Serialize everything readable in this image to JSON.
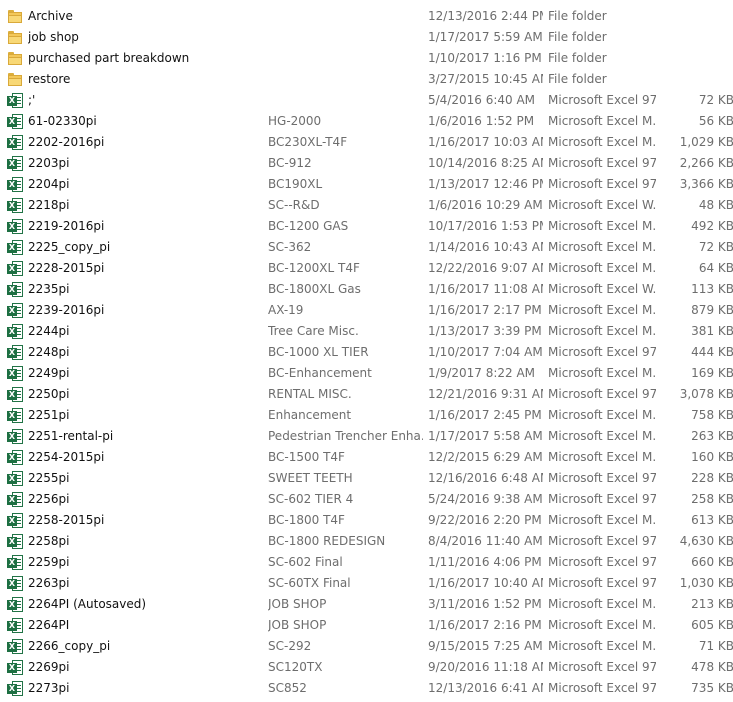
{
  "files": [
    {
      "name": "Archive",
      "title": "",
      "date": "12/13/2016 2:44 PM",
      "type": "File folder",
      "size": "",
      "icon": "folder-icon"
    },
    {
      "name": "job shop",
      "title": "",
      "date": "1/17/2017 5:59 AM",
      "type": "File folder",
      "size": "",
      "icon": "folder-icon"
    },
    {
      "name": "purchased part breakdown",
      "title": "",
      "date": "1/10/2017 1:16 PM",
      "type": "File folder",
      "size": "",
      "icon": "folder-icon"
    },
    {
      "name": "restore",
      "title": "",
      "date": "3/27/2015 10:45 AM",
      "type": "File folder",
      "size": "",
      "icon": "folder-icon"
    },
    {
      "name": ";'",
      "title": "",
      "date": "5/4/2016 6:40 AM",
      "type": "Microsoft Excel 97...",
      "size": "72 KB",
      "icon": "excel-icon"
    },
    {
      "name": "61-02330pi",
      "title": "HG-2000",
      "date": "1/6/2016 1:52 PM",
      "type": "Microsoft Excel M...",
      "size": "56 KB",
      "icon": "excel-icon"
    },
    {
      "name": "2202-2016pi",
      "title": "BC230XL-T4F",
      "date": "1/16/2017 10:03 AM",
      "type": "Microsoft Excel M...",
      "size": "1,029 KB",
      "icon": "excel-icon"
    },
    {
      "name": "2203pi",
      "title": "BC-912",
      "date": "10/14/2016 8:25 AM",
      "type": "Microsoft Excel 97...",
      "size": "2,266 KB",
      "icon": "excel-icon"
    },
    {
      "name": "2204pi",
      "title": "BC190XL",
      "date": "1/13/2017 12:46 PM",
      "type": "Microsoft Excel 97...",
      "size": "3,366 KB",
      "icon": "excel-icon"
    },
    {
      "name": "2218pi",
      "title": "SC--R&D",
      "date": "1/6/2016 10:29 AM",
      "type": "Microsoft Excel W...",
      "size": "48 KB",
      "icon": "excel-icon"
    },
    {
      "name": "2219-2016pi",
      "title": "BC-1200 GAS",
      "date": "10/17/2016 1:53 PM",
      "type": "Microsoft Excel M...",
      "size": "492 KB",
      "icon": "excel-icon"
    },
    {
      "name": "2225_copy_pi",
      "title": "SC-362",
      "date": "1/14/2016 10:43 AM",
      "type": "Microsoft Excel M...",
      "size": "72 KB",
      "icon": "excel-icon"
    },
    {
      "name": "2228-2015pi",
      "title": "BC-1200XL T4F",
      "date": "12/22/2016 9:07 AM",
      "type": "Microsoft Excel M...",
      "size": "64 KB",
      "icon": "excel-icon"
    },
    {
      "name": "2235pi",
      "title": "BC-1800XL  Gas",
      "date": "1/16/2017 11:08 AM",
      "type": "Microsoft Excel W...",
      "size": "113 KB",
      "icon": "excel-icon"
    },
    {
      "name": "2239-2016pi",
      "title": "AX-19",
      "date": "1/16/2017 2:17 PM",
      "type": "Microsoft Excel M...",
      "size": "879 KB",
      "icon": "excel-icon"
    },
    {
      "name": "2244pi",
      "title": "Tree Care Misc.",
      "date": "1/13/2017 3:39 PM",
      "type": "Microsoft Excel M...",
      "size": "381 KB",
      "icon": "excel-icon"
    },
    {
      "name": "2248pi",
      "title": "BC-1000 XL TIER",
      "date": "1/10/2017 7:04 AM",
      "type": "Microsoft Excel 97...",
      "size": "444 KB",
      "icon": "excel-icon"
    },
    {
      "name": "2249pi",
      "title": "BC-Enhancement",
      "date": "1/9/2017 8:22 AM",
      "type": "Microsoft Excel M...",
      "size": "169 KB",
      "icon": "excel-icon"
    },
    {
      "name": "2250pi",
      "title": "RENTAL MISC.",
      "date": "12/21/2016 9:31 AM",
      "type": "Microsoft Excel 97...",
      "size": "3,078 KB",
      "icon": "excel-icon"
    },
    {
      "name": "2251pi",
      "title": "Enhancement",
      "date": "1/16/2017 2:45 PM",
      "type": "Microsoft Excel M...",
      "size": "758 KB",
      "icon": "excel-icon"
    },
    {
      "name": "2251-rental-pi",
      "title": "Pedestrian Trencher Enha...",
      "date": "1/17/2017 5:58 AM",
      "type": "Microsoft Excel M...",
      "size": "263 KB",
      "icon": "excel-icon"
    },
    {
      "name": "2254-2015pi",
      "title": "BC-1500 T4F",
      "date": "12/2/2015 6:29 AM",
      "type": "Microsoft Excel M...",
      "size": "160 KB",
      "icon": "excel-icon"
    },
    {
      "name": "2255pi",
      "title": "SWEET TEETH",
      "date": "12/16/2016 6:48 AM",
      "type": "Microsoft Excel 97...",
      "size": "228 KB",
      "icon": "excel-icon"
    },
    {
      "name": "2256pi",
      "title": "SC-602 TIER 4",
      "date": "5/24/2016 9:38 AM",
      "type": "Microsoft Excel 97...",
      "size": "258 KB",
      "icon": "excel-icon"
    },
    {
      "name": "2258-2015pi",
      "title": "BC-1800 T4F",
      "date": "9/22/2016 2:20 PM",
      "type": "Microsoft Excel M...",
      "size": "613 KB",
      "icon": "excel-icon"
    },
    {
      "name": "2258pi",
      "title": "BC-1800 REDESIGN",
      "date": "8/4/2016 11:40 AM",
      "type": "Microsoft Excel 97...",
      "size": "4,630 KB",
      "icon": "excel-icon"
    },
    {
      "name": "2259pi",
      "title": "SC-602 Final",
      "date": "1/11/2016 4:06 PM",
      "type": "Microsoft Excel 97...",
      "size": "660 KB",
      "icon": "excel-icon"
    },
    {
      "name": "2263pi",
      "title": "SC-60TX Final",
      "date": "1/16/2017 10:40 AM",
      "type": "Microsoft Excel 97...",
      "size": "1,030 KB",
      "icon": "excel-icon"
    },
    {
      "name": "2264PI (Autosaved)",
      "title": "JOB SHOP",
      "date": "3/11/2016 1:52 PM",
      "type": "Microsoft Excel M...",
      "size": "213 KB",
      "icon": "excel-icon"
    },
    {
      "name": "2264PI",
      "title": "JOB SHOP",
      "date": "1/16/2017 2:16 PM",
      "type": "Microsoft Excel M...",
      "size": "605 KB",
      "icon": "excel-icon"
    },
    {
      "name": "2266_copy_pi",
      "title": "SC-292",
      "date": "9/15/2015 7:25 AM",
      "type": "Microsoft Excel M...",
      "size": "71 KB",
      "icon": "excel-icon"
    },
    {
      "name": "2269pi",
      "title": "SC120TX",
      "date": "9/20/2016 11:18 AM",
      "type": "Microsoft Excel 97...",
      "size": "478 KB",
      "icon": "excel-icon"
    },
    {
      "name": "2273pi",
      "title": "SC852",
      "date": "12/13/2016 6:41 AM",
      "type": "Microsoft Excel 97...",
      "size": "735 KB",
      "icon": "excel-icon"
    }
  ]
}
